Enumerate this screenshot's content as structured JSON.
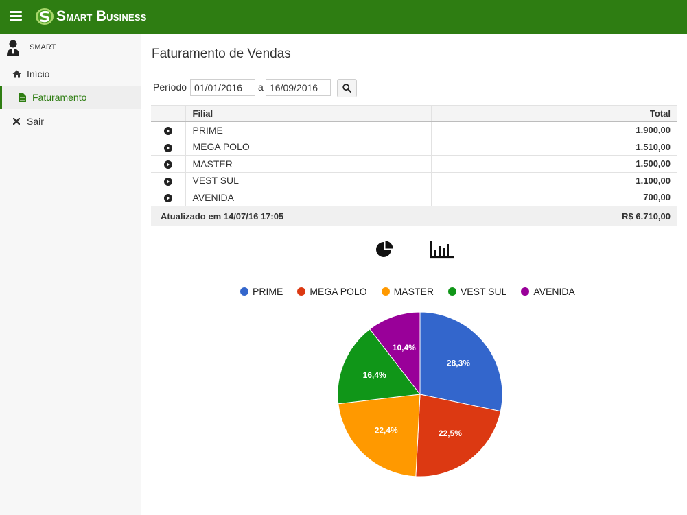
{
  "app": {
    "brand_first": "S",
    "brand_rest": "mart ",
    "brand_second_first": "B",
    "brand_second_rest": "usiness"
  },
  "sidebar": {
    "user": "SMART",
    "items": [
      {
        "label": "Início",
        "icon": "home-icon"
      },
      {
        "label": "Faturamento",
        "icon": "file-icon",
        "active": true
      },
      {
        "label": "Sair",
        "icon": "close-icon"
      }
    ]
  },
  "page": {
    "title": "Faturamento de Vendas",
    "periodo_label": "Período",
    "date_from": "01/01/2016",
    "separator": "a",
    "date_to": "16/09/2016"
  },
  "table": {
    "headers": [
      "",
      "Filial",
      "Total"
    ],
    "rows": [
      {
        "filial": "PRIME",
        "total": "1.900,00"
      },
      {
        "filial": "MEGA POLO",
        "total": "1.510,00"
      },
      {
        "filial": "MASTER",
        "total": "1.500,00"
      },
      {
        "filial": "VEST SUL",
        "total": "1.100,00"
      },
      {
        "filial": "AVENIDA",
        "total": "700,00"
      }
    ],
    "footer_label": "Atualizado em 14/07/16 17:05",
    "footer_total": "R$ 6.710,00"
  },
  "colors": {
    "topbar": "#2e7d12",
    "accent": "#2e7d12"
  },
  "chart_data": {
    "type": "pie",
    "legend_position": "top",
    "slices": [
      {
        "label": "PRIME",
        "value": 1900,
        "percent_label": "28,3%",
        "color": "#3366cc"
      },
      {
        "label": "MEGA POLO",
        "value": 1510,
        "percent_label": "22,5%",
        "color": "#dc3912"
      },
      {
        "label": "MASTER",
        "value": 1500,
        "percent_label": "22,4%",
        "color": "#ff9900"
      },
      {
        "label": "VEST SUL",
        "value": 1100,
        "percent_label": "16,4%",
        "color": "#109618"
      },
      {
        "label": "AVENIDA",
        "value": 700,
        "percent_label": "10,4%",
        "color": "#990099"
      }
    ]
  }
}
